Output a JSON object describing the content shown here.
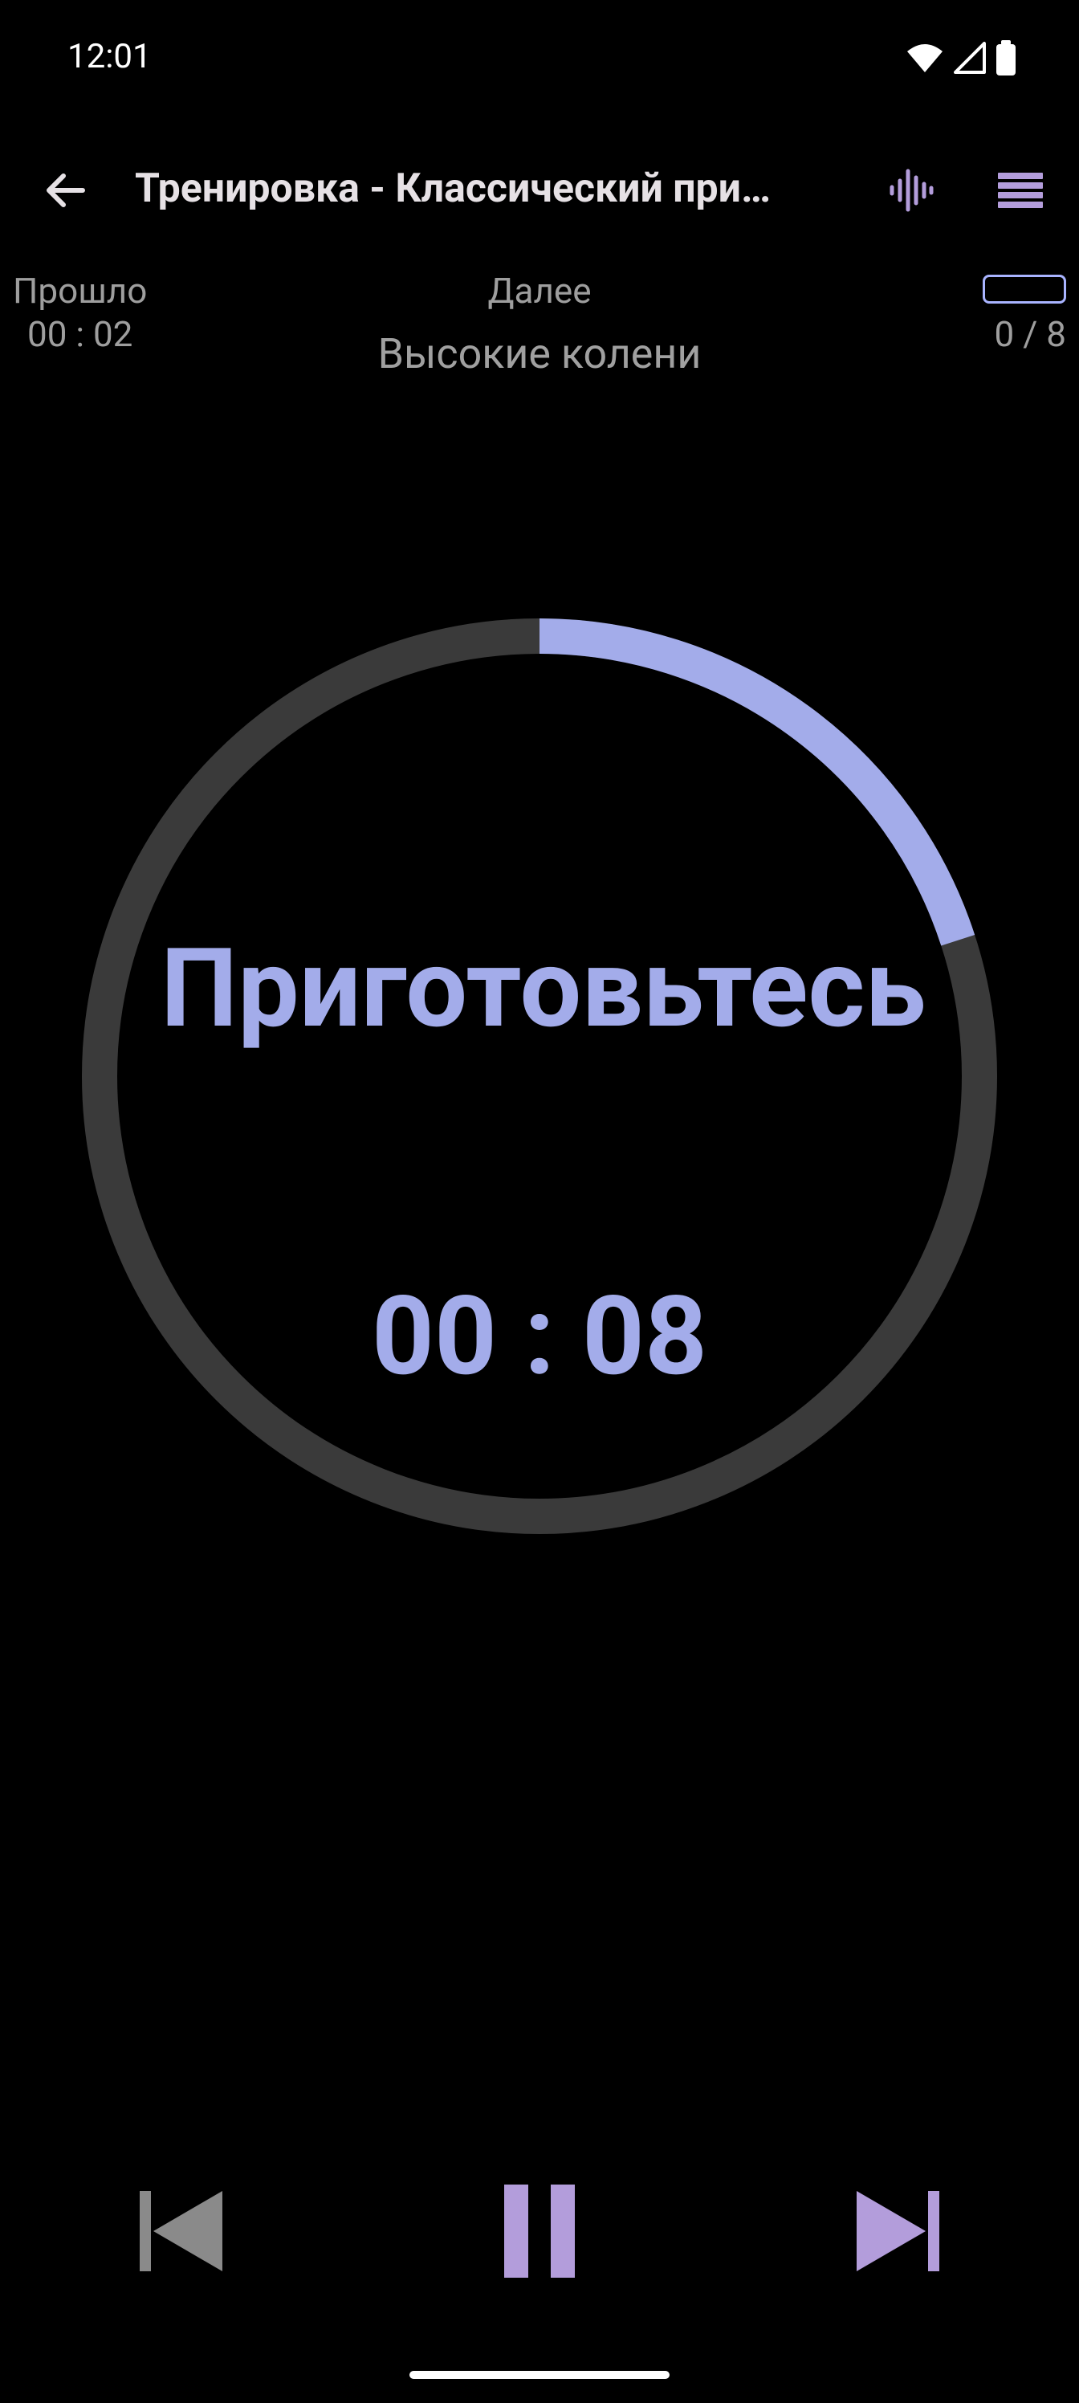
{
  "status_bar": {
    "time": "12:01",
    "icons": [
      "wifi-icon",
      "cellular-signal-icon",
      "battery-icon"
    ]
  },
  "app_bar": {
    "title": "Тренировка - Классический при…",
    "icons": [
      "back-arrow-icon",
      "sound-wave-icon",
      "list-menu-icon"
    ]
  },
  "info": {
    "elapsed_label": "Прошло",
    "elapsed_value": "00 : 02",
    "next_label": "Далее",
    "next_exercise": "Высокие колени",
    "counter": "0 / 8",
    "workout_progress_fraction": 0
  },
  "timer": {
    "phase_text": "Приготовьтесь",
    "time_left": "00 : 08",
    "elapsed_fraction": 0.2
  },
  "controls": {
    "icons": [
      "skip-previous-icon",
      "pause-icon",
      "skip-next-icon"
    ]
  },
  "colors": {
    "accent": "#a3acea",
    "accent_purple": "#b39ddb",
    "ring_track": "#3a3a3a",
    "background": "#000000",
    "secondary_text": "#9e9e9e"
  }
}
